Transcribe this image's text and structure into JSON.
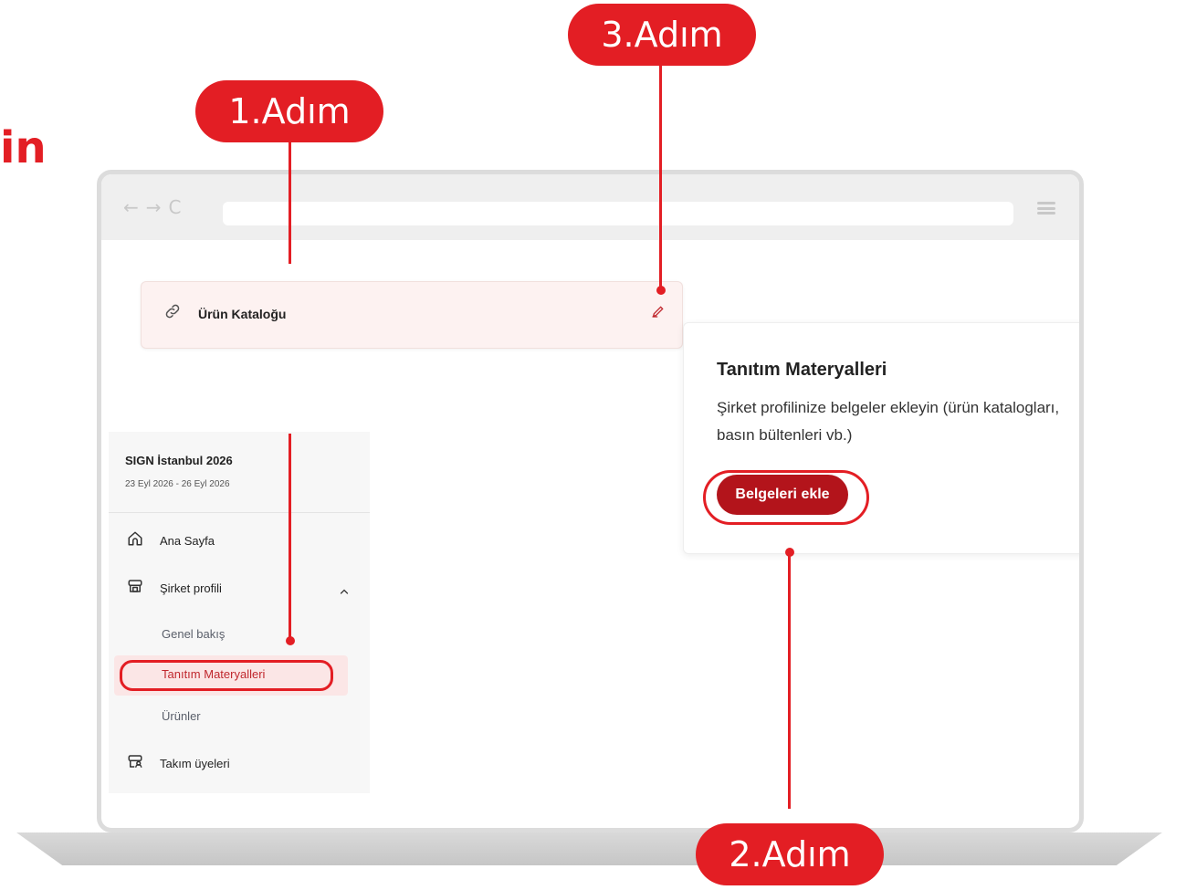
{
  "heading_fragment": "in",
  "steps": {
    "step1": "1.Adım",
    "step2": "2.Adım",
    "step3": "3.Adım"
  },
  "browser": {
    "nav_back_icon": "arrow-left-icon",
    "nav_forward_icon": "arrow-right-icon",
    "reload_icon": "reload-icon",
    "menu_icon": "hamburger-icon"
  },
  "link_card": {
    "title": "Ürün Kataloğu",
    "icon": "link-icon",
    "edit_icon": "pencil-icon"
  },
  "promo_card": {
    "title": "Tanıtım Materyalleri",
    "description": "Şirket profilinize belgeler ekleyin (ürün katalogları, basın bültenleri vb.)",
    "button_label": "Belgeleri ekle"
  },
  "sidebar": {
    "event_name": "SIGN İstanbul 2026",
    "event_dates": "23 Eyl 2026 - 26 Eyl 2026",
    "items": [
      {
        "label": "Ana Sayfa",
        "icon": "home-icon"
      },
      {
        "label": "Şirket profili",
        "icon": "store-icon",
        "expanded": true
      },
      {
        "label": "Takım üyeleri",
        "icon": "team-icon"
      }
    ],
    "sub_items": [
      {
        "label": "Genel bakış"
      },
      {
        "label": "Tanıtım Materyalleri",
        "active": true
      },
      {
        "label": "Ürünler"
      }
    ]
  },
  "colors": {
    "accent": "#e31e24",
    "button": "#b3141b",
    "active_bg": "#fbe6e6"
  }
}
